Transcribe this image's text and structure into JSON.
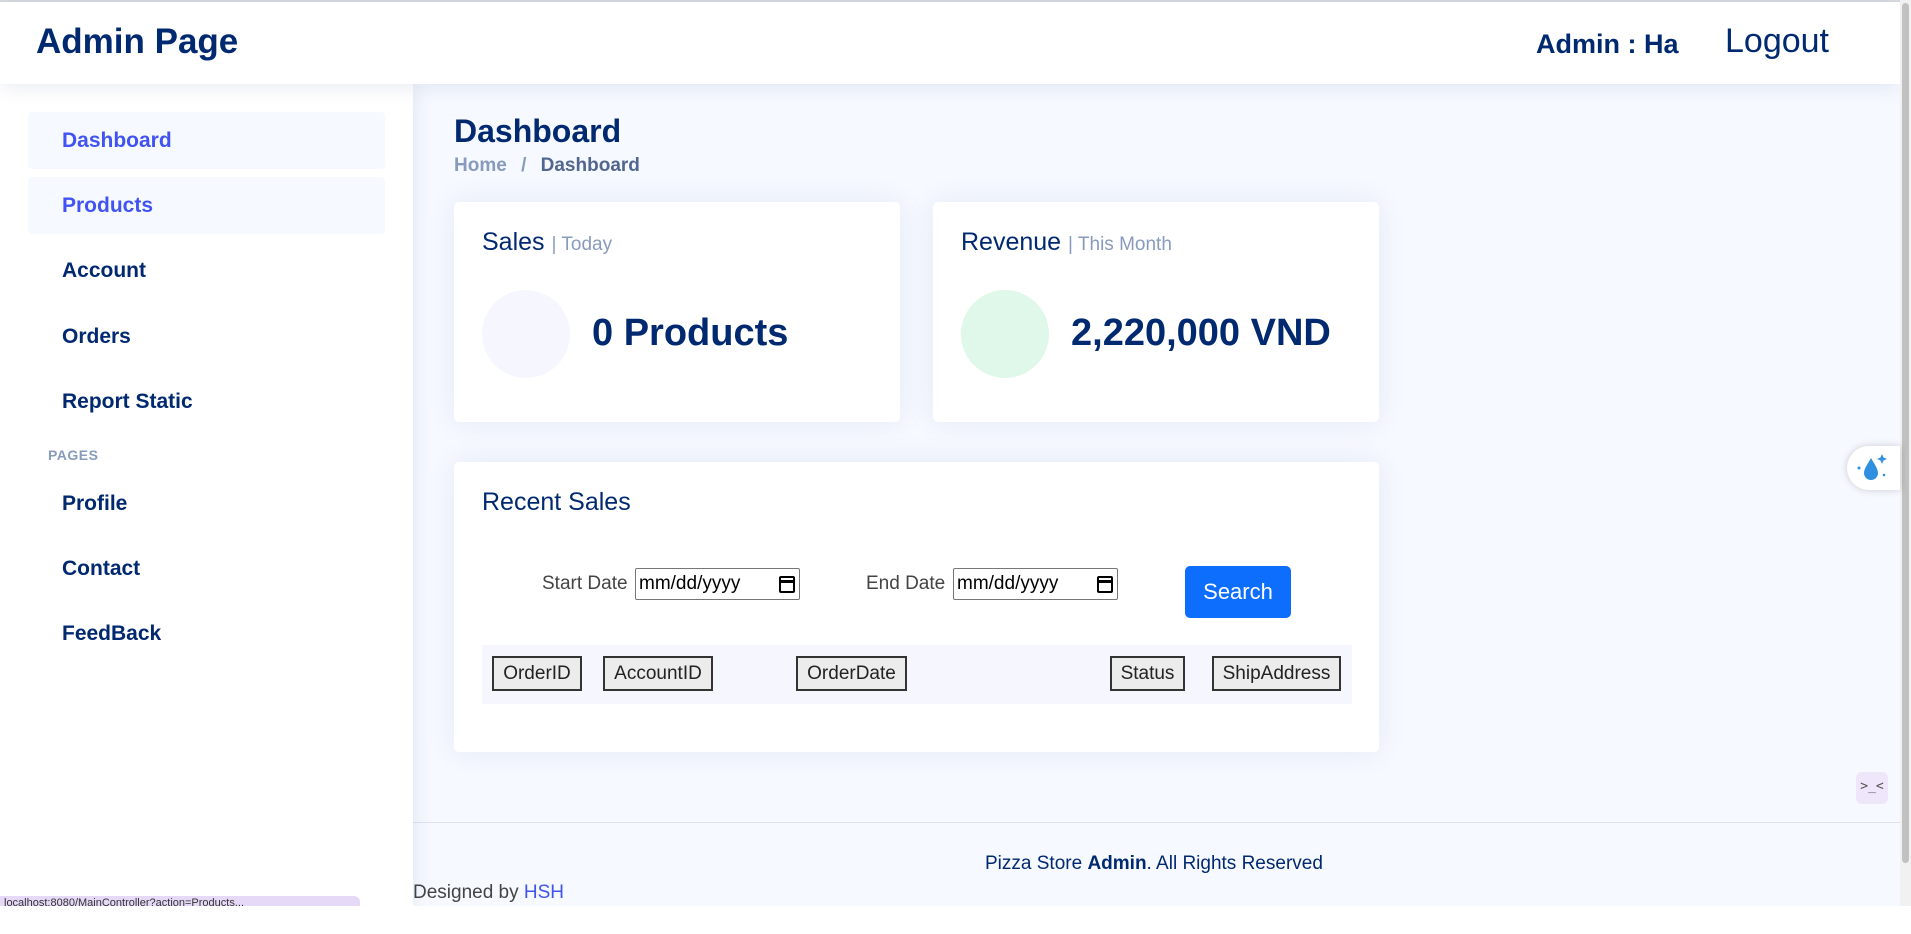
{
  "header": {
    "brand": "Admin Page",
    "admin_label": "Admin : Ha",
    "logout_label": "Logout"
  },
  "sidebar": {
    "items": [
      {
        "label": "Dashboard"
      },
      {
        "label": "Products"
      },
      {
        "label": "Account"
      },
      {
        "label": "Orders"
      },
      {
        "label": "Report Static"
      }
    ],
    "pages_heading": "PAGES",
    "pages_items": [
      {
        "label": "Profile"
      },
      {
        "label": "Contact"
      },
      {
        "label": "FeedBack"
      }
    ],
    "url_tip": "localhost:8080/MainController?action=Products..."
  },
  "main": {
    "title": "Dashboard",
    "breadcrumb": {
      "home": "Home",
      "separator": "/",
      "current": "Dashboard"
    }
  },
  "sales_card": {
    "title": "Sales",
    "subtitle": "| Today",
    "value": "0 Products",
    "icon_color": "#f6f6fe"
  },
  "revenue_card": {
    "title": "Revenue",
    "subtitle": "| This Month",
    "value": "2,220,000 VND",
    "icon_color": "#e0f8e9"
  },
  "recent_sales": {
    "title": "Recent Sales",
    "start_date_label": "Start Date",
    "start_date_value": "mm/dd/yyyy",
    "end_date_label": "End Date",
    "end_date_value": "mm/dd/yyyy",
    "search_label": "Search",
    "columns": [
      "OrderID",
      "AccountID",
      "OrderDate",
      "Status",
      "ShipAddress"
    ]
  },
  "footer": {
    "prefix": "Pizza Store",
    "strong": "Admin",
    "suffix": ". All Rights Reserved",
    "designed_by": "Designed by",
    "designer": "HSH"
  },
  "floating": {
    "code_glyph": ">_<"
  },
  "colors": {
    "primary": "#012970",
    "accent": "#4154f1",
    "button": "#0d6efd",
    "background": "#f6f9ff"
  }
}
